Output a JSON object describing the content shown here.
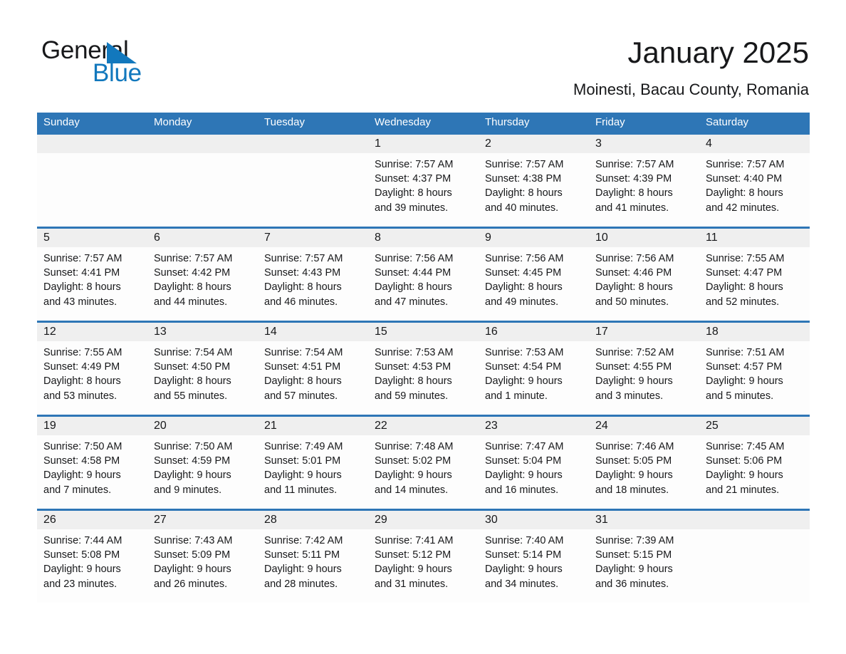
{
  "brand": {
    "name_part1": "General",
    "name_part2": "Blue",
    "triangle_color": "#1278bd",
    "text_color": "#17181a"
  },
  "header": {
    "title": "January 2025",
    "location": "Moinesti, Bacau County, Romania"
  },
  "colors": {
    "header_blue": "#2e76b6",
    "daynum_band": "#efefef",
    "cell_background": "#fdfdfd",
    "text": "#17181a"
  },
  "calendar": {
    "weekday_headers": [
      "Sunday",
      "Monday",
      "Tuesday",
      "Wednesday",
      "Thursday",
      "Friday",
      "Saturday"
    ],
    "weeks": [
      {
        "days": [
          {
            "num": "",
            "l1": "",
            "l2": "",
            "l3": "",
            "l4": ""
          },
          {
            "num": "",
            "l1": "",
            "l2": "",
            "l3": "",
            "l4": ""
          },
          {
            "num": "",
            "l1": "",
            "l2": "",
            "l3": "",
            "l4": ""
          },
          {
            "num": "1",
            "l1": "Sunrise: 7:57 AM",
            "l2": "Sunset: 4:37 PM",
            "l3": "Daylight: 8 hours",
            "l4": "and 39 minutes."
          },
          {
            "num": "2",
            "l1": "Sunrise: 7:57 AM",
            "l2": "Sunset: 4:38 PM",
            "l3": "Daylight: 8 hours",
            "l4": "and 40 minutes."
          },
          {
            "num": "3",
            "l1": "Sunrise: 7:57 AM",
            "l2": "Sunset: 4:39 PM",
            "l3": "Daylight: 8 hours",
            "l4": "and 41 minutes."
          },
          {
            "num": "4",
            "l1": "Sunrise: 7:57 AM",
            "l2": "Sunset: 4:40 PM",
            "l3": "Daylight: 8 hours",
            "l4": "and 42 minutes."
          }
        ]
      },
      {
        "days": [
          {
            "num": "5",
            "l1": "Sunrise: 7:57 AM",
            "l2": "Sunset: 4:41 PM",
            "l3": "Daylight: 8 hours",
            "l4": "and 43 minutes."
          },
          {
            "num": "6",
            "l1": "Sunrise: 7:57 AM",
            "l2": "Sunset: 4:42 PM",
            "l3": "Daylight: 8 hours",
            "l4": "and 44 minutes."
          },
          {
            "num": "7",
            "l1": "Sunrise: 7:57 AM",
            "l2": "Sunset: 4:43 PM",
            "l3": "Daylight: 8 hours",
            "l4": "and 46 minutes."
          },
          {
            "num": "8",
            "l1": "Sunrise: 7:56 AM",
            "l2": "Sunset: 4:44 PM",
            "l3": "Daylight: 8 hours",
            "l4": "and 47 minutes."
          },
          {
            "num": "9",
            "l1": "Sunrise: 7:56 AM",
            "l2": "Sunset: 4:45 PM",
            "l3": "Daylight: 8 hours",
            "l4": "and 49 minutes."
          },
          {
            "num": "10",
            "l1": "Sunrise: 7:56 AM",
            "l2": "Sunset: 4:46 PM",
            "l3": "Daylight: 8 hours",
            "l4": "and 50 minutes."
          },
          {
            "num": "11",
            "l1": "Sunrise: 7:55 AM",
            "l2": "Sunset: 4:47 PM",
            "l3": "Daylight: 8 hours",
            "l4": "and 52 minutes."
          }
        ]
      },
      {
        "days": [
          {
            "num": "12",
            "l1": "Sunrise: 7:55 AM",
            "l2": "Sunset: 4:49 PM",
            "l3": "Daylight: 8 hours",
            "l4": "and 53 minutes."
          },
          {
            "num": "13",
            "l1": "Sunrise: 7:54 AM",
            "l2": "Sunset: 4:50 PM",
            "l3": "Daylight: 8 hours",
            "l4": "and 55 minutes."
          },
          {
            "num": "14",
            "l1": "Sunrise: 7:54 AM",
            "l2": "Sunset: 4:51 PM",
            "l3": "Daylight: 8 hours",
            "l4": "and 57 minutes."
          },
          {
            "num": "15",
            "l1": "Sunrise: 7:53 AM",
            "l2": "Sunset: 4:53 PM",
            "l3": "Daylight: 8 hours",
            "l4": "and 59 minutes."
          },
          {
            "num": "16",
            "l1": "Sunrise: 7:53 AM",
            "l2": "Sunset: 4:54 PM",
            "l3": "Daylight: 9 hours",
            "l4": "and 1 minute."
          },
          {
            "num": "17",
            "l1": "Sunrise: 7:52 AM",
            "l2": "Sunset: 4:55 PM",
            "l3": "Daylight: 9 hours",
            "l4": "and 3 minutes."
          },
          {
            "num": "18",
            "l1": "Sunrise: 7:51 AM",
            "l2": "Sunset: 4:57 PM",
            "l3": "Daylight: 9 hours",
            "l4": "and 5 minutes."
          }
        ]
      },
      {
        "days": [
          {
            "num": "19",
            "l1": "Sunrise: 7:50 AM",
            "l2": "Sunset: 4:58 PM",
            "l3": "Daylight: 9 hours",
            "l4": "and 7 minutes."
          },
          {
            "num": "20",
            "l1": "Sunrise: 7:50 AM",
            "l2": "Sunset: 4:59 PM",
            "l3": "Daylight: 9 hours",
            "l4": "and 9 minutes."
          },
          {
            "num": "21",
            "l1": "Sunrise: 7:49 AM",
            "l2": "Sunset: 5:01 PM",
            "l3": "Daylight: 9 hours",
            "l4": "and 11 minutes."
          },
          {
            "num": "22",
            "l1": "Sunrise: 7:48 AM",
            "l2": "Sunset: 5:02 PM",
            "l3": "Daylight: 9 hours",
            "l4": "and 14 minutes."
          },
          {
            "num": "23",
            "l1": "Sunrise: 7:47 AM",
            "l2": "Sunset: 5:04 PM",
            "l3": "Daylight: 9 hours",
            "l4": "and 16 minutes."
          },
          {
            "num": "24",
            "l1": "Sunrise: 7:46 AM",
            "l2": "Sunset: 5:05 PM",
            "l3": "Daylight: 9 hours",
            "l4": "and 18 minutes."
          },
          {
            "num": "25",
            "l1": "Sunrise: 7:45 AM",
            "l2": "Sunset: 5:06 PM",
            "l3": "Daylight: 9 hours",
            "l4": "and 21 minutes."
          }
        ]
      },
      {
        "days": [
          {
            "num": "26",
            "l1": "Sunrise: 7:44 AM",
            "l2": "Sunset: 5:08 PM",
            "l3": "Daylight: 9 hours",
            "l4": "and 23 minutes."
          },
          {
            "num": "27",
            "l1": "Sunrise: 7:43 AM",
            "l2": "Sunset: 5:09 PM",
            "l3": "Daylight: 9 hours",
            "l4": "and 26 minutes."
          },
          {
            "num": "28",
            "l1": "Sunrise: 7:42 AM",
            "l2": "Sunset: 5:11 PM",
            "l3": "Daylight: 9 hours",
            "l4": "and 28 minutes."
          },
          {
            "num": "29",
            "l1": "Sunrise: 7:41 AM",
            "l2": "Sunset: 5:12 PM",
            "l3": "Daylight: 9 hours",
            "l4": "and 31 minutes."
          },
          {
            "num": "30",
            "l1": "Sunrise: 7:40 AM",
            "l2": "Sunset: 5:14 PM",
            "l3": "Daylight: 9 hours",
            "l4": "and 34 minutes."
          },
          {
            "num": "31",
            "l1": "Sunrise: 7:39 AM",
            "l2": "Sunset: 5:15 PM",
            "l3": "Daylight: 9 hours",
            "l4": "and 36 minutes."
          },
          {
            "num": "",
            "l1": "",
            "l2": "",
            "l3": "",
            "l4": ""
          }
        ]
      }
    ]
  }
}
